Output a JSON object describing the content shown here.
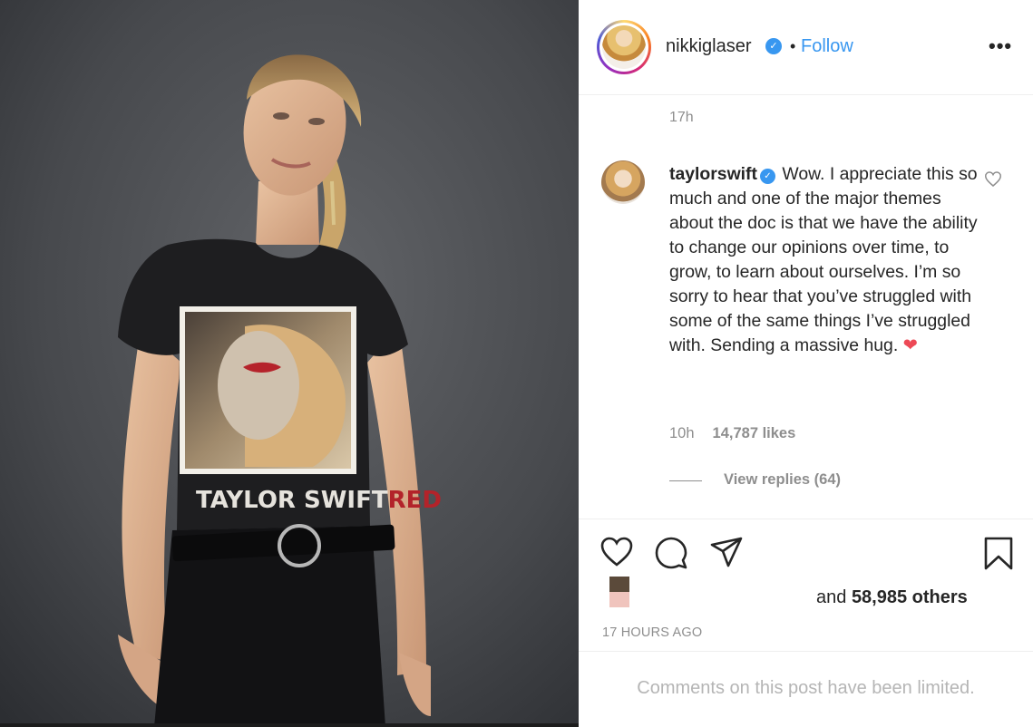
{
  "post": {
    "author": {
      "username": "nikkiglaser",
      "verified_icon": "verified-badge-icon",
      "separator": "•",
      "follow_label": "Follow"
    },
    "more_label": "•••",
    "caption_time": "17h",
    "shirt_text": {
      "main": "TAYLOR SWIFT",
      "accent": "RED"
    },
    "comment": {
      "username": "taylorswift",
      "text": "Wow. I appreciate this so much and one of the major themes about the doc is that we have the ability to change our opinions over time, to grow, to learn about ourselves. I’m so sorry to hear that you’ve struggled with some of the same things I’ve struggled with. Sending a massive hug.",
      "emoji": "❤",
      "time": "10h",
      "likes": "14,787 likes",
      "view_replies": "View replies (64)"
    },
    "actions": {
      "like_icon": "heart-outline-icon",
      "comment_icon": "speech-bubble-icon",
      "share_icon": "paper-plane-icon",
      "save_icon": "bookmark-icon"
    },
    "liked_by": {
      "prefix": "and ",
      "count": "58,985 others"
    },
    "timestamp": "17 HOURS AGO",
    "comments_limited": "Comments on this post have been limited."
  },
  "colors": {
    "link_blue": "#3897f0",
    "text": "#262626",
    "muted": "#8e8e8e",
    "heart_red": "#ed4956"
  }
}
